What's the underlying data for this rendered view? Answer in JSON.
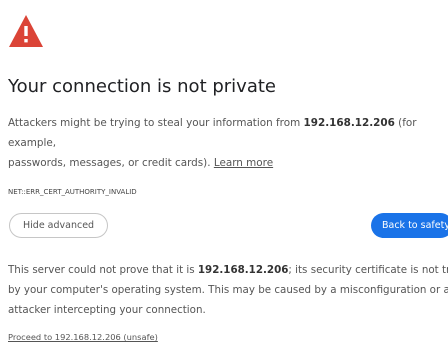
{
  "icon": {
    "name": "warning-icon",
    "color": "#db4437"
  },
  "heading": "Your connection is not private",
  "main_message": {
    "line1_prefix": "Attackers might be trying to steal your information from ",
    "host": "192.168.12.206",
    "line1_suffix": " (for example,",
    "line2": "passwords, messages, or credit cards). ",
    "learn_more": "Learn more"
  },
  "error_code": "NET::ERR_CERT_AUTHORITY_INVALID",
  "buttons": {
    "hide_advanced": "Hide advanced",
    "back_to_safety": "Back to safety",
    "primary_color": "#1a73e8"
  },
  "details": {
    "line1_prefix": "This server could not prove that it is ",
    "host": "192.168.12.206",
    "line1_suffix": "; its security certificate is not trusted",
    "line2": "by your computer's operating system. This may be caused by a misconfiguration or an",
    "line3": "attacker intercepting your connection."
  },
  "proceed_link": "Proceed to 192.168.12.206 (unsafe)"
}
